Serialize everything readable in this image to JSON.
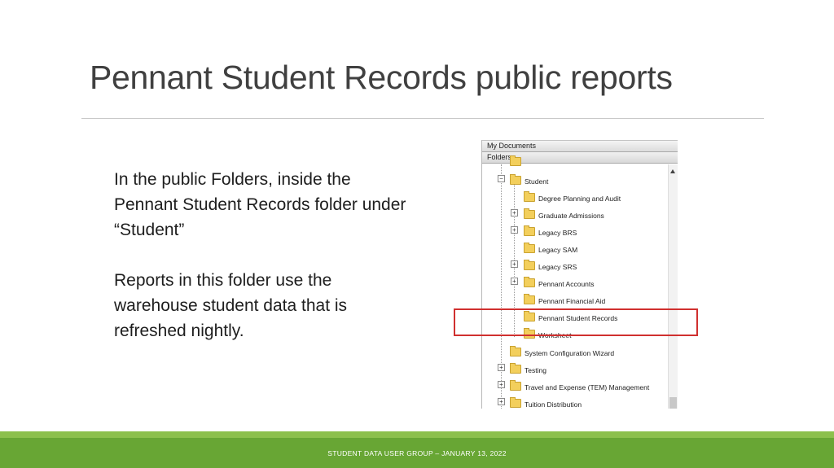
{
  "slide": {
    "title": "Pennant Student Records public reports",
    "paragraph1": "In the public Folders, inside the Pennant Student Records folder under “Student”",
    "paragraph2": "Reports in this folder use the warehouse student data that is refreshed nightly.",
    "footer": "STUDENT DATA USER GROUP – JANUARY 13, 2022"
  },
  "screenshot": {
    "header1": "My Documents",
    "header2": "Folders",
    "top_node": "Student",
    "children": [
      "Degree Planning and Audit",
      "Graduate Admissions",
      "Legacy BRS",
      "Legacy SAM",
      "Legacy SRS",
      "Pennant Accounts",
      "Pennant Financial Aid",
      "Pennant Student Records",
      "Worksheet"
    ],
    "siblings": [
      "System Configuration Wizard",
      "Testing",
      "Travel and Expense (TEM) Management",
      "Tuition Distribution"
    ],
    "highlighted_item": "Pennant Student Records",
    "highlight_color": "#d0302f"
  },
  "colors": {
    "footer_green": "#68a634",
    "footer_light_green": "#8cc04c",
    "title_gray": "#404040"
  }
}
